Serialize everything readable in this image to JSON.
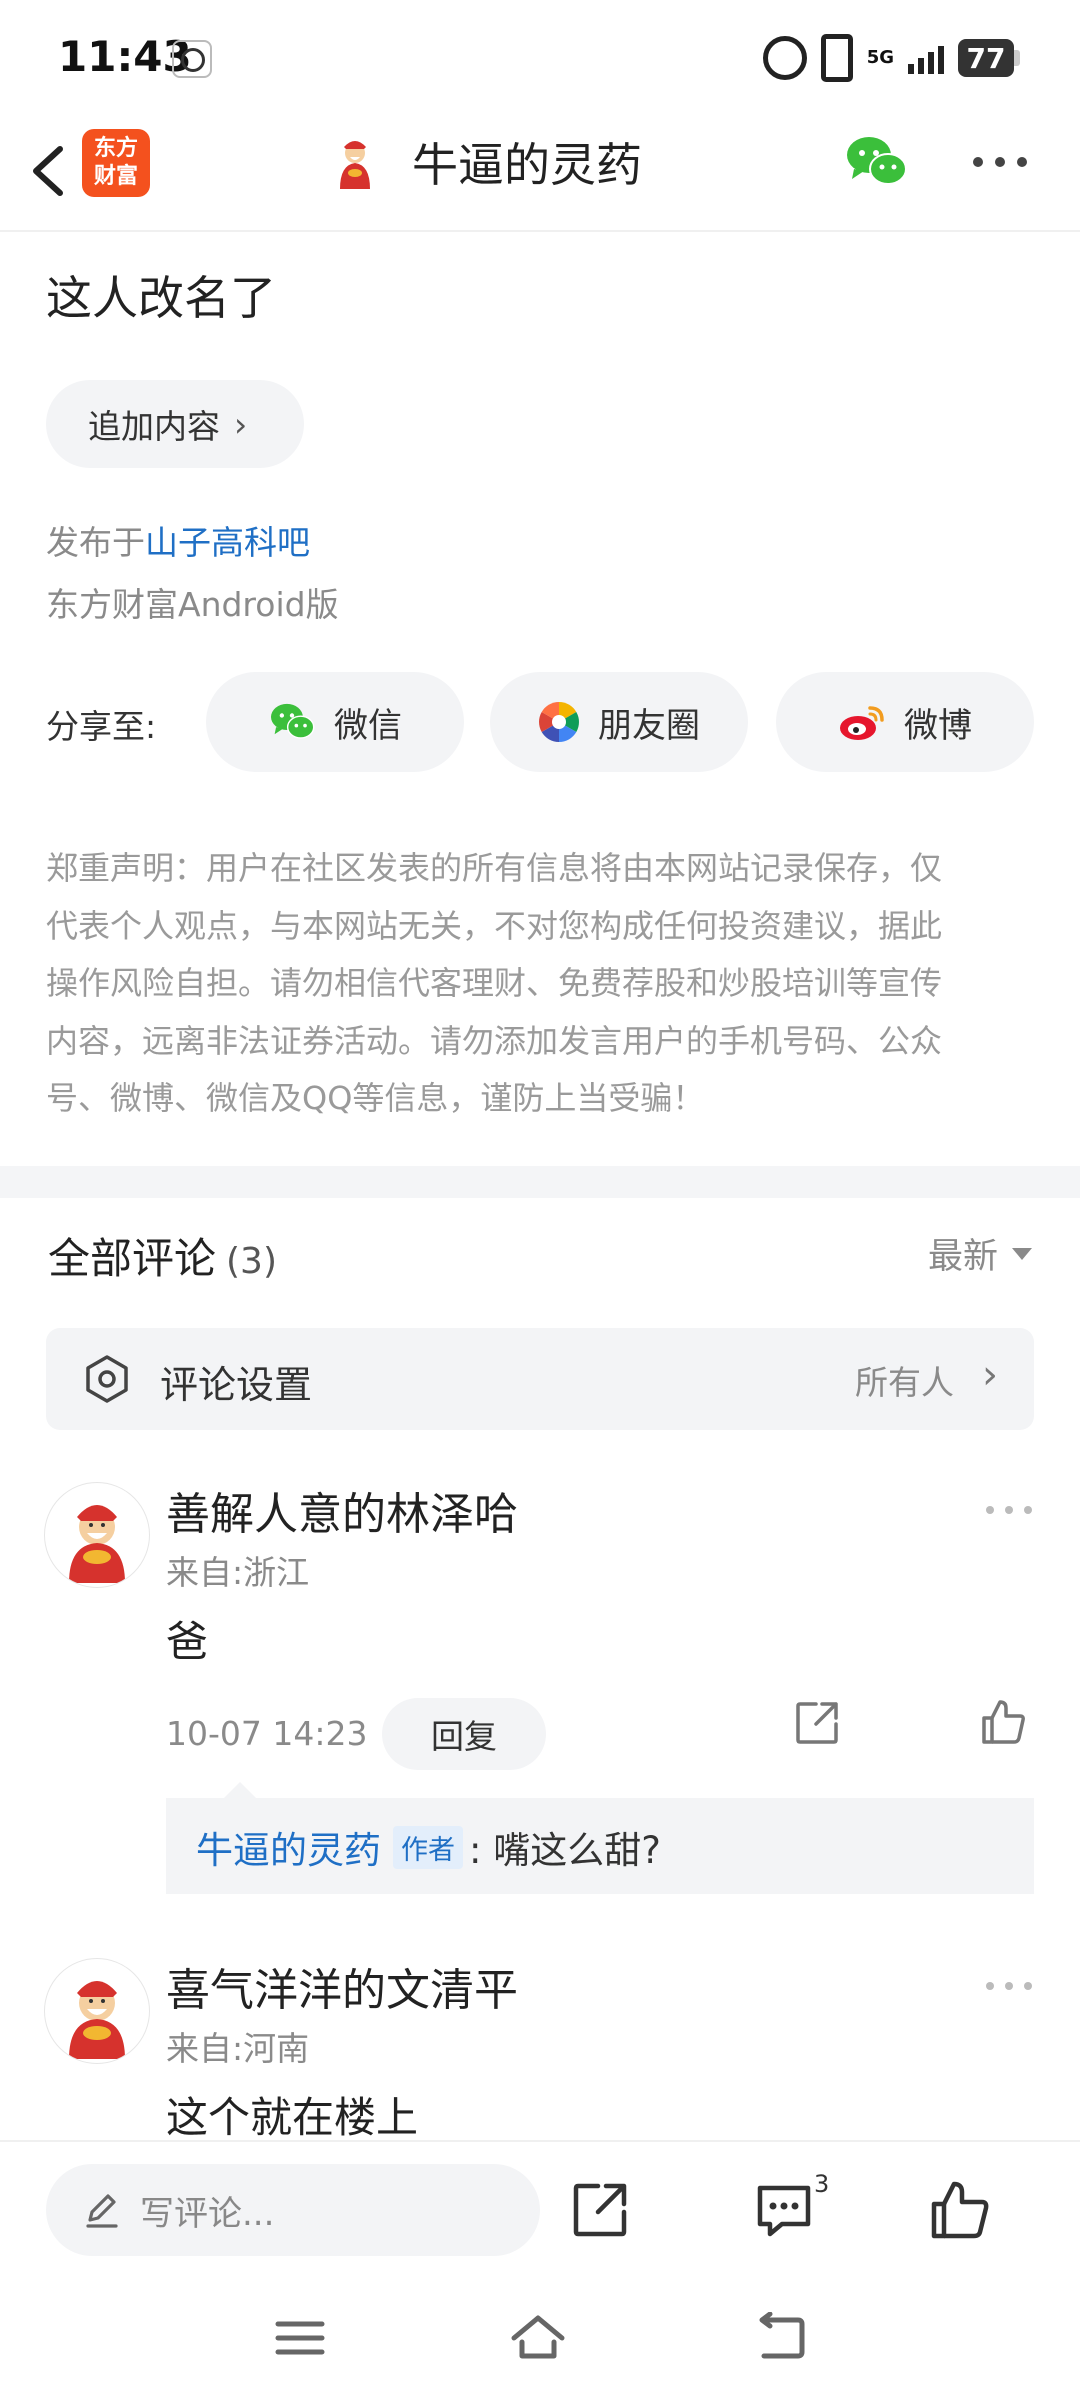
{
  "status_bar": {
    "time": "11:43",
    "network": "5G",
    "battery": "77"
  },
  "header": {
    "logo_line1": "东方",
    "logo_line2": "财富",
    "title": "牛逼的灵药"
  },
  "post": {
    "title": "这人改名了",
    "append_label": "追加内容",
    "published_prefix": "发布于",
    "bar_name": "山子高科吧",
    "client": "东方财富Android版",
    "share_label": "分享至:",
    "share_targets": [
      {
        "label": "微信",
        "icon": "wechat-icon"
      },
      {
        "label": "朋友圈",
        "icon": "moments-icon"
      },
      {
        "label": "微博",
        "icon": "weibo-icon"
      }
    ],
    "disclaimer_lines": [
      "郑重声明：用户在社区发表的所有信息将由本网站记录保存，仅",
      "代表个人观点，与本网站无关，不对您构成任何投资建议，据此",
      "操作风险自担。请勿相信代客理财、免费荐股和炒股培训等宣传",
      "内容，远离非法证券活动。请勿添加发言用户的手机号码、公众",
      "号、微博、微信及QQ等信息，谨防上当受骗！"
    ]
  },
  "comments_section": {
    "title": "全部评论",
    "count": "(3)",
    "sort": "最新",
    "settings_label": "评论设置",
    "settings_value": "所有人",
    "comments": [
      {
        "name": "善解人意的林泽哈",
        "location": "来自:浙江",
        "text": "爸",
        "time": "10-07 14:23",
        "reply_label": "回复",
        "reply": {
          "author": "牛逼的灵药",
          "tag": "作者",
          "text": ": 嘴这么甜?"
        }
      },
      {
        "name": "喜气洋洋的文清平",
        "location": "来自:河南",
        "text": "这个就在楼上"
      }
    ]
  },
  "bottom_bar": {
    "write_placeholder": "写评论...",
    "comment_badge": "3"
  },
  "colors": {
    "accent_blue": "#1f6fc5",
    "logo_orange": "#f4511e",
    "wechat_green": "#3bbf3b"
  }
}
